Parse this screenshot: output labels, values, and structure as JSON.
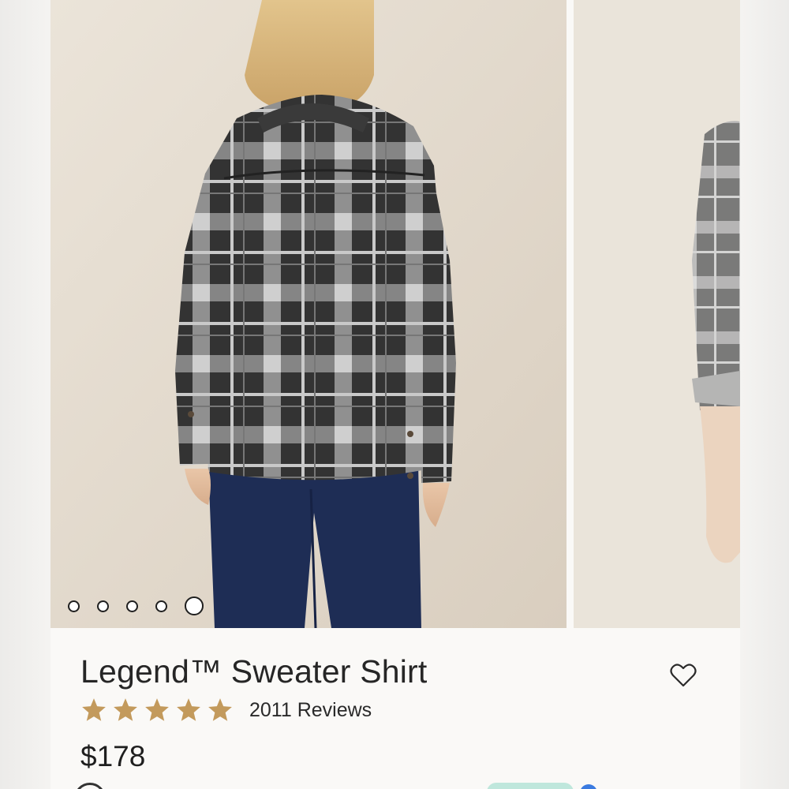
{
  "product": {
    "title": "Legend™ Sweater Shirt",
    "rating": 5,
    "reviews_label": "2011 Reviews",
    "price": "$178"
  },
  "carousel": {
    "slide_count": 5,
    "active_slide": 5
  },
  "colors": {
    "star": "#c39a5c",
    "background_wall": "#ddd3c5",
    "plaid_dark": "#2f2f2f",
    "plaid_light": "#bdbdbd",
    "jeans": "#1e2d55"
  },
  "icons": {
    "favorite": "heart-outline-icon",
    "rating_star": "star-filled-icon"
  }
}
